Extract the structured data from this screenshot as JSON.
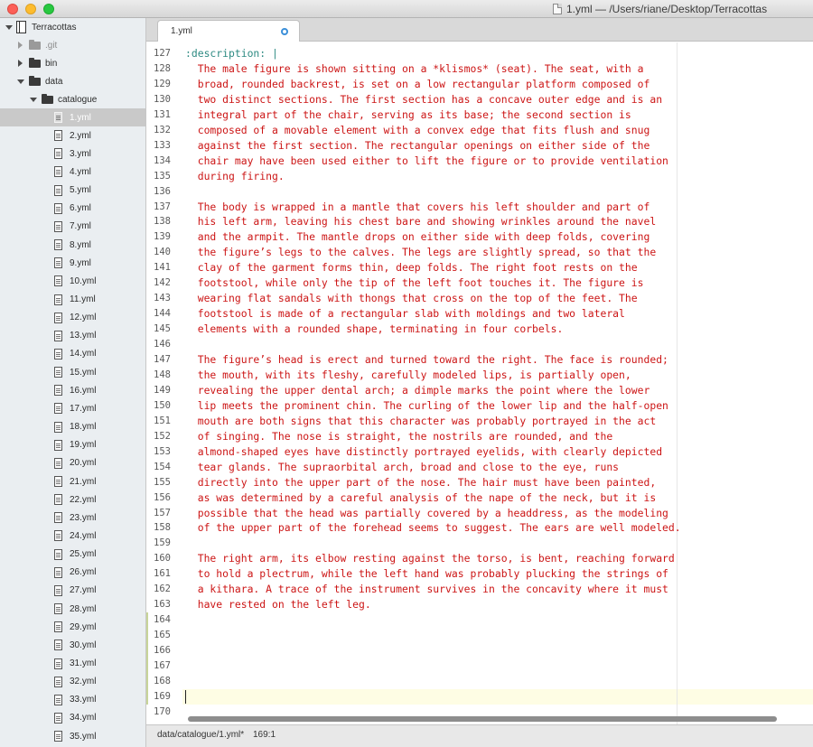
{
  "window": {
    "title": "1.yml — /Users/riane/Desktop/Terracottas"
  },
  "sidebar": {
    "project": "Terracottas",
    "items": [
      {
        "label": ".git",
        "kind": "folder",
        "state": "collapsed",
        "muted": true
      },
      {
        "label": "bin",
        "kind": "folder",
        "state": "collapsed"
      },
      {
        "label": "data",
        "kind": "folder",
        "state": "expanded"
      },
      {
        "label": "catalogue",
        "kind": "folder",
        "state": "expanded"
      }
    ],
    "files": [
      "1.yml",
      "2.yml",
      "3.yml",
      "4.yml",
      "5.yml",
      "6.yml",
      "7.yml",
      "8.yml",
      "9.yml",
      "10.yml",
      "11.yml",
      "12.yml",
      "13.yml",
      "14.yml",
      "15.yml",
      "16.yml",
      "17.yml",
      "18.yml",
      "19.yml",
      "20.yml",
      "21.yml",
      "22.yml",
      "23.yml",
      "24.yml",
      "25.yml",
      "26.yml",
      "27.yml",
      "28.yml",
      "29.yml",
      "30.yml",
      "31.yml",
      "32.yml",
      "33.yml",
      "34.yml",
      "35.yml"
    ],
    "selected_file": "1.yml"
  },
  "tab": {
    "label": "1.yml"
  },
  "editor": {
    "lines": [
      {
        "n": "127",
        "text": ":description: |",
        "key": true
      },
      {
        "n": "128",
        "text": "  The male figure is shown sitting on a *klismos* (seat). The seat, with a"
      },
      {
        "n": "129",
        "text": "  broad, rounded backrest, is set on a low rectangular platform composed of"
      },
      {
        "n": "130",
        "text": "  two distinct sections. The first section has a concave outer edge and is an"
      },
      {
        "n": "131",
        "text": "  integral part of the chair, serving as its base; the second section is"
      },
      {
        "n": "132",
        "text": "  composed of a movable element with a convex edge that fits flush and snug"
      },
      {
        "n": "133",
        "text": "  against the first section. The rectangular openings on either side of the"
      },
      {
        "n": "134",
        "text": "  chair may have been used either to lift the figure or to provide ventilation"
      },
      {
        "n": "135",
        "text": "  during firing."
      },
      {
        "n": "136",
        "text": ""
      },
      {
        "n": "137",
        "text": "  The body is wrapped in a mantle that covers his left shoulder and part of"
      },
      {
        "n": "138",
        "text": "  his left arm, leaving his chest bare and showing wrinkles around the navel"
      },
      {
        "n": "139",
        "text": "  and the armpit. The mantle drops on either side with deep folds, covering"
      },
      {
        "n": "140",
        "text": "  the figure’s legs to the calves. The legs are slightly spread, so that the"
      },
      {
        "n": "141",
        "text": "  clay of the garment forms thin, deep folds. The right foot rests on the"
      },
      {
        "n": "142",
        "text": "  footstool, while only the tip of the left foot touches it. The figure is"
      },
      {
        "n": "143",
        "text": "  wearing flat sandals with thongs that cross on the top of the feet. The"
      },
      {
        "n": "144",
        "text": "  footstool is made of a rectangular slab with moldings and two lateral"
      },
      {
        "n": "145",
        "text": "  elements with a rounded shape, terminating in four corbels."
      },
      {
        "n": "146",
        "text": ""
      },
      {
        "n": "147",
        "text": "  The figure’s head is erect and turned toward the right. The face is rounded;"
      },
      {
        "n": "148",
        "text": "  the mouth, with its fleshy, carefully modeled lips, is partially open,"
      },
      {
        "n": "149",
        "text": "  revealing the upper dental arch; a dimple marks the point where the lower"
      },
      {
        "n": "150",
        "text": "  lip meets the prominent chin. The curling of the lower lip and the half-open"
      },
      {
        "n": "151",
        "text": "  mouth are both signs that this character was probably portrayed in the act"
      },
      {
        "n": "152",
        "text": "  of singing. The nose is straight, the nostrils are rounded, and the"
      },
      {
        "n": "153",
        "text": "  almond-shaped eyes have distinctly portrayed eyelids, with clearly depicted"
      },
      {
        "n": "154",
        "text": "  tear glands. The supraorbital arch, broad and close to the eye, runs"
      },
      {
        "n": "155",
        "text": "  directly into the upper part of the nose. The hair must have been painted,"
      },
      {
        "n": "156",
        "text": "  as was determined by a careful analysis of the nape of the neck, but it is"
      },
      {
        "n": "157",
        "text": "  possible that the head was partially covered by a headdress, as the modeling"
      },
      {
        "n": "158",
        "text": "  of the upper part of the forehead seems to suggest. The ears are well modeled."
      },
      {
        "n": "159",
        "text": ""
      },
      {
        "n": "160",
        "text": "  The right arm, its elbow resting against the torso, is bent, reaching forward"
      },
      {
        "n": "161",
        "text": "  to hold a plectrum, while the left hand was probably plucking the strings of"
      },
      {
        "n": "162",
        "text": "  a kithara. A trace of the instrument survives in the concavity where it must"
      },
      {
        "n": "163",
        "text": "  have rested on the left leg."
      },
      {
        "n": "164",
        "text": ""
      },
      {
        "n": "165",
        "text": ""
      },
      {
        "n": "166",
        "text": ""
      },
      {
        "n": "167",
        "text": ""
      },
      {
        "n": "168",
        "text": ""
      },
      {
        "n": "169",
        "text": "",
        "current": true
      },
      {
        "n": "170",
        "text": ""
      }
    ]
  },
  "status": {
    "path": "data/catalogue/1.yml*",
    "position": "169:1"
  },
  "colors": {
    "string": "#cc1515",
    "key": "#2d8a82",
    "selection": "#c9c9c9",
    "current_line": "#fefde4",
    "modified_dot": "#3b8fd9"
  }
}
